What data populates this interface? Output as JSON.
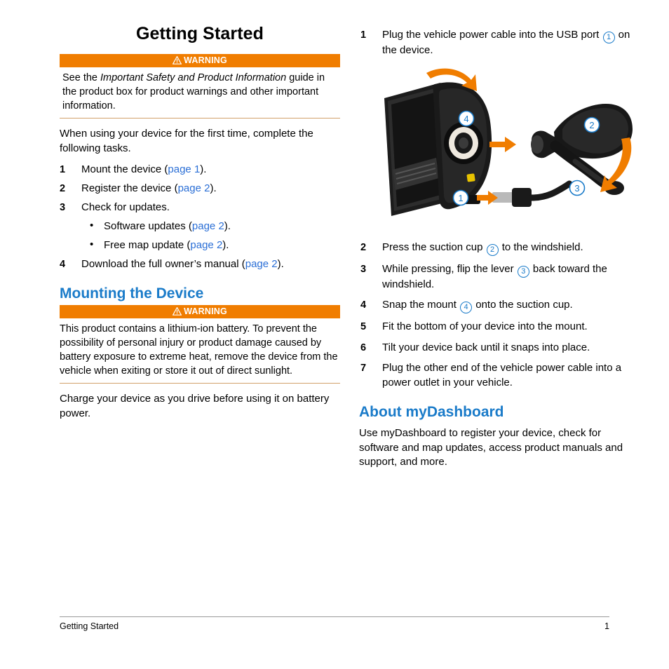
{
  "page": {
    "title": "Getting Started",
    "footer_left": "Getting Started",
    "footer_right": "1",
    "accent_warning": "#f07d00",
    "accent_link": "#2b6fd6",
    "accent_heading": "#1a7bc9"
  },
  "left": {
    "warning1": {
      "label": "WARNING",
      "text_before": "See the ",
      "italic": "Important Safety and Product Information",
      "text_after": " guide in the product box for product warnings and other important information."
    },
    "intro": "When using your device for the first time, complete the following tasks.",
    "steps": [
      {
        "num": "1",
        "text_before": "Mount the device (",
        "link": "page 1",
        "text_after": ")."
      },
      {
        "num": "2",
        "text_before": "Register the device (",
        "link": "page 2",
        "text_after": ")."
      },
      {
        "num": "3",
        "text_before": "Check for updates.",
        "link": "",
        "text_after": "",
        "sub": [
          {
            "bullet": "•",
            "text_before": "Software updates (",
            "link": "page 2",
            "text_after": ")."
          },
          {
            "bullet": "•",
            "text_before": "Free map update (",
            "link": "page 2",
            "text_after": ")."
          }
        ]
      },
      {
        "num": "4",
        "text_before": "Download the full owner’s manual (",
        "link": "page 2",
        "text_after": ")."
      }
    ],
    "section_title": "Mounting the Device",
    "warning2": {
      "label": "WARNING",
      "text": "This product contains a lithium-ion battery. To prevent the possibility of personal injury or product damage caused by battery exposure to extreme heat, remove the device from the vehicle when exiting or store it out of direct sunlight."
    },
    "closing": "Charge your device as you drive before using it on battery power."
  },
  "right": {
    "steps": [
      {
        "num": "1",
        "parts": [
          {
            "t": "text",
            "v": "Plug the vehicle power cable into the USB port "
          },
          {
            "t": "callout",
            "v": "①"
          },
          {
            "t": "text",
            "v": " on the device."
          }
        ]
      },
      {
        "num": "2",
        "parts": [
          {
            "t": "text",
            "v": "Press the suction cup "
          },
          {
            "t": "callout",
            "v": "②"
          },
          {
            "t": "text",
            "v": " to the windshield."
          }
        ]
      },
      {
        "num": "3",
        "parts": [
          {
            "t": "text",
            "v": "While pressing, flip the lever "
          },
          {
            "t": "callout",
            "v": "③"
          },
          {
            "t": "text",
            "v": " back toward the windshield."
          }
        ]
      },
      {
        "num": "4",
        "parts": [
          {
            "t": "text",
            "v": "Snap the mount "
          },
          {
            "t": "callout",
            "v": "④"
          },
          {
            "t": "text",
            "v": " onto the suction cup."
          }
        ]
      },
      {
        "num": "5",
        "parts": [
          {
            "t": "text",
            "v": "Fit the bottom of your device into the mount."
          }
        ]
      },
      {
        "num": "6",
        "parts": [
          {
            "t": "text",
            "v": "Tilt your device back until it snaps into place."
          }
        ]
      },
      {
        "num": "7",
        "parts": [
          {
            "t": "text",
            "v": "Plug the other end of the vehicle power cable into a power outlet in your vehicle."
          }
        ]
      }
    ],
    "section_title": "About myDashboard",
    "section_body": "Use myDashboard to register your device, check for software and map updates, access product manuals and support, and more.",
    "figure": {
      "alt": "Illustration of GPS device, mount and suction cup with numbered callouts",
      "callouts": [
        "1",
        "2",
        "3",
        "4"
      ]
    }
  }
}
